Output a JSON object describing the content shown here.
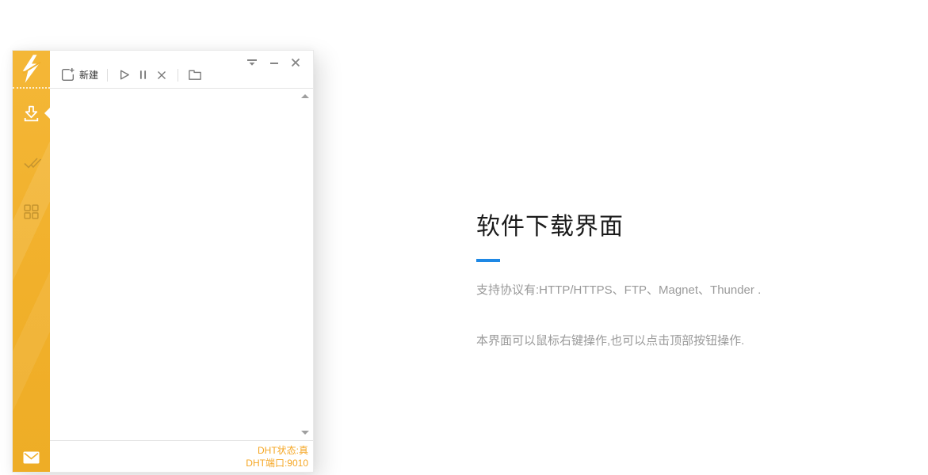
{
  "window": {
    "toolbar": {
      "new_label": "新建"
    },
    "sidebar": {
      "items": [
        {
          "name": "downloads",
          "icon": "download-icon",
          "active": true
        },
        {
          "name": "completed",
          "icon": "double-check-icon",
          "active": false
        },
        {
          "name": "categories",
          "icon": "grid-icon",
          "active": false
        },
        {
          "name": "messages",
          "icon": "envelope-icon",
          "active": false
        }
      ]
    },
    "status": {
      "dht_state": "DHT状态:真",
      "dht_port": "DHT端口:9010"
    }
  },
  "content": {
    "title": "软件下载界面",
    "paragraphs": [
      "支持协议有:HTTP/HTTPS、FTP、Magnet、Thunder .",
      "本界面可以鼠标右键操作,也可以点击顶部按钮操作."
    ]
  },
  "colors": {
    "sidebar_gold": "#F1B02B",
    "sidebar_icon_muted": "#C6952F",
    "accent_blue": "#1E88E5",
    "status_orange": "#F5A623",
    "title_text": "#1C1C1C",
    "body_text": "#9A9A9A"
  }
}
